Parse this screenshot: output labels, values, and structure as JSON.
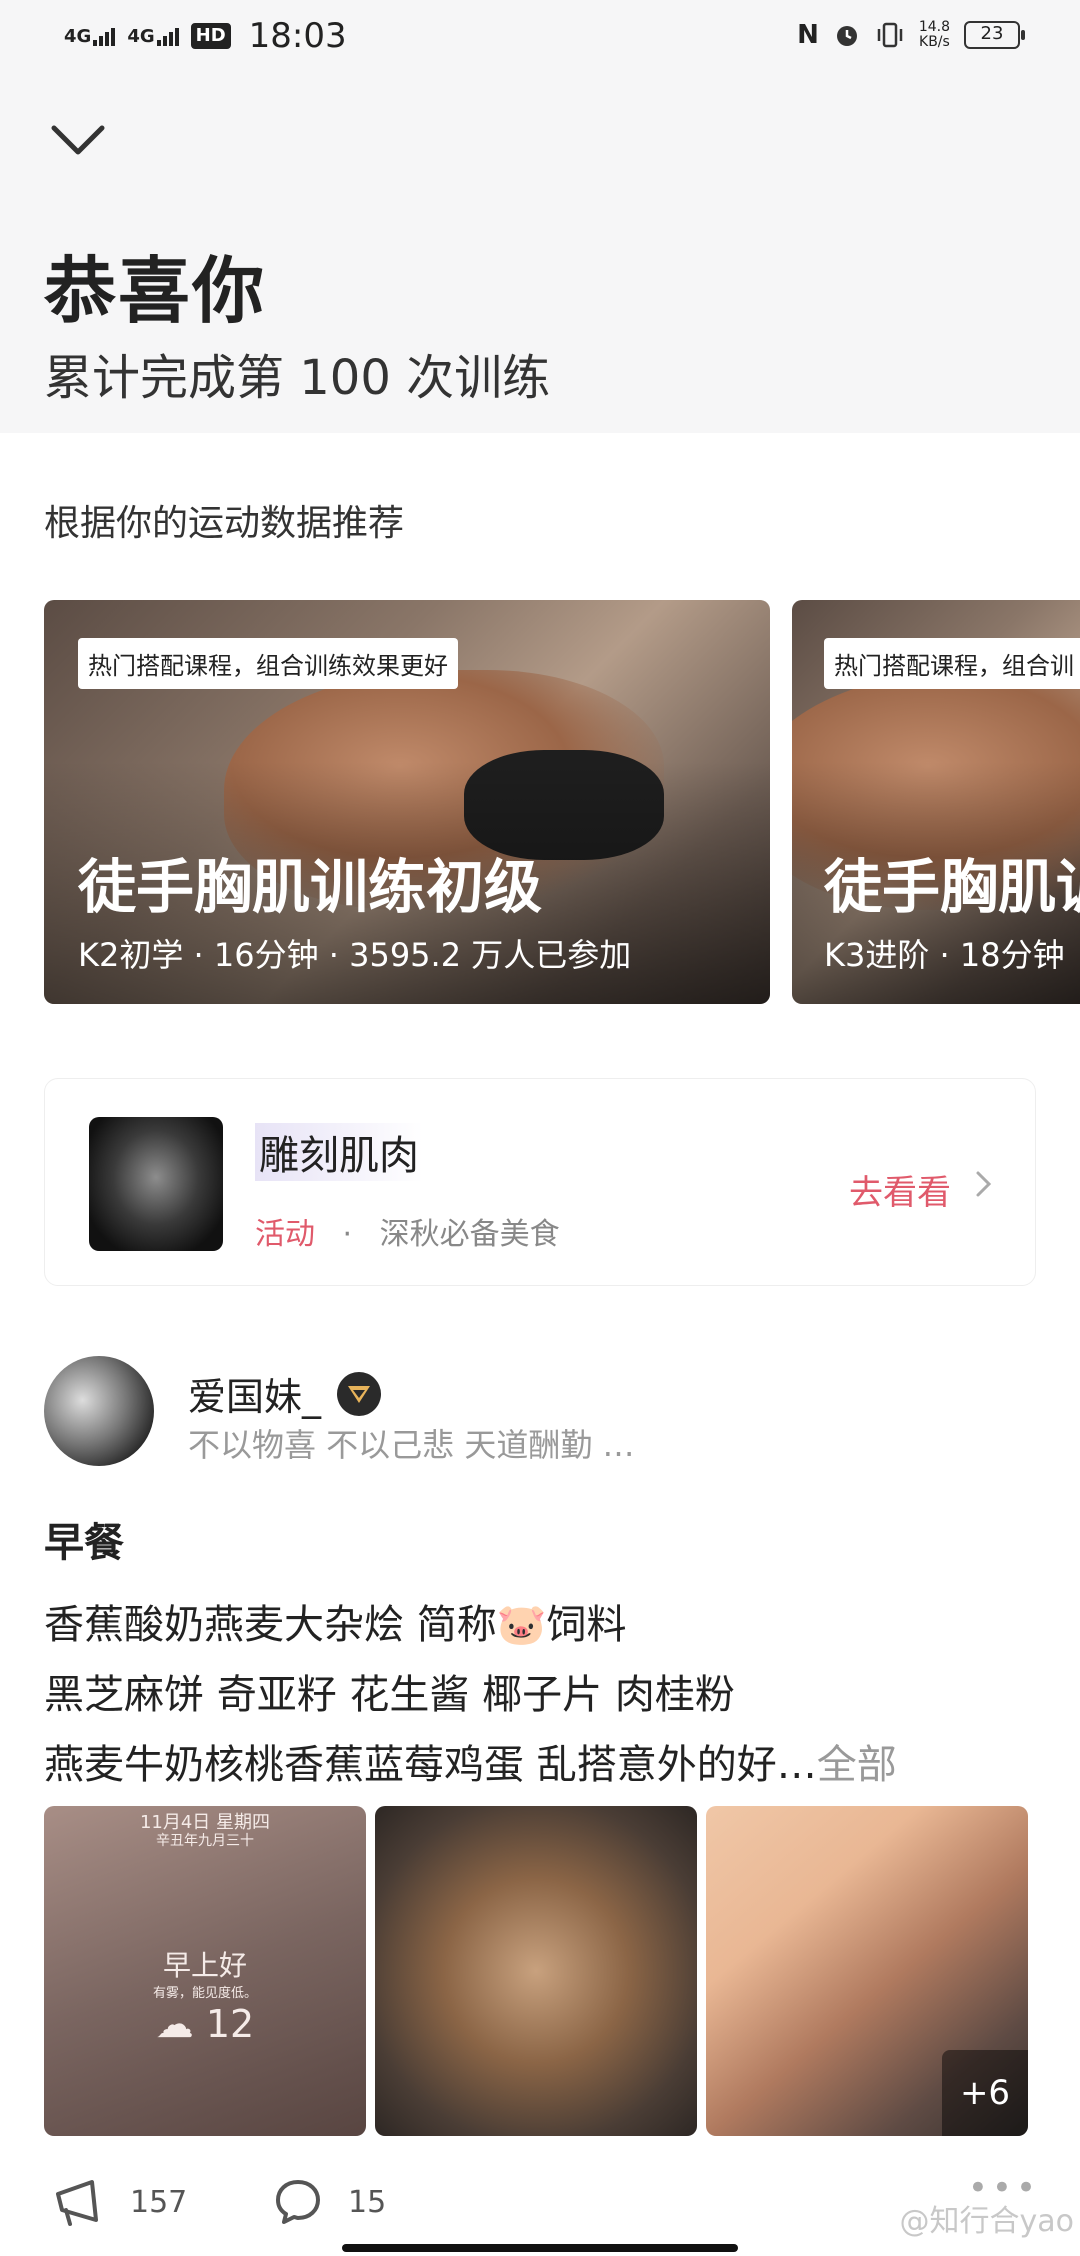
{
  "status_bar": {
    "network1": "4G",
    "network2": "4G",
    "hd": "HD",
    "time": "18:03",
    "nfc": "N",
    "speed_value": "14.8",
    "speed_unit": "KB/s",
    "battery": "23"
  },
  "header": {
    "title": "恭喜你",
    "subtitle": "累计完成第 100 次训练"
  },
  "recommend": {
    "section_title": "根据你的运动数据推荐",
    "cards": [
      {
        "tag": "热门搭配课程，组合训练效果更好",
        "title": "徒手胸肌训练初级",
        "meta": "K2初学 · 16分钟 · 3595.2 万人已参加"
      },
      {
        "tag": "热门搭配课程，组合训",
        "title": "徒手胸肌训",
        "meta": "K3进阶 · 18分钟"
      }
    ]
  },
  "activity": {
    "name": "雕刻肌肉",
    "category": "活动",
    "separator": "·",
    "desc": "深秋必备美食",
    "cta": "去看看"
  },
  "post": {
    "user_name": "爱国妹_",
    "signature": "不以物喜 不以己悲 天道酬勤 …",
    "title": "早餐",
    "lines": [
      "香蕉酸奶燕麦大杂烩 简称🐷饲料",
      "黑芝麻饼 奇亚籽 花生酱 椰子片 肉桂粉",
      "燕麦牛奶核桃香蕉蓝莓鸡蛋 乱搭意外的好…"
    ],
    "more": "全部",
    "image1": {
      "date": "11月4日 星期四",
      "lunar": "辛丑年九月三十",
      "greeting": "早上好",
      "note": "有雾，能见度低。",
      "weather": "☁ 12"
    },
    "extra_images": "+6",
    "likes": "157",
    "comments": "15"
  },
  "watermark": "@知行合yao",
  "colors": {
    "accent": "#e05a6b",
    "top_bg": "#f6f6f7"
  }
}
